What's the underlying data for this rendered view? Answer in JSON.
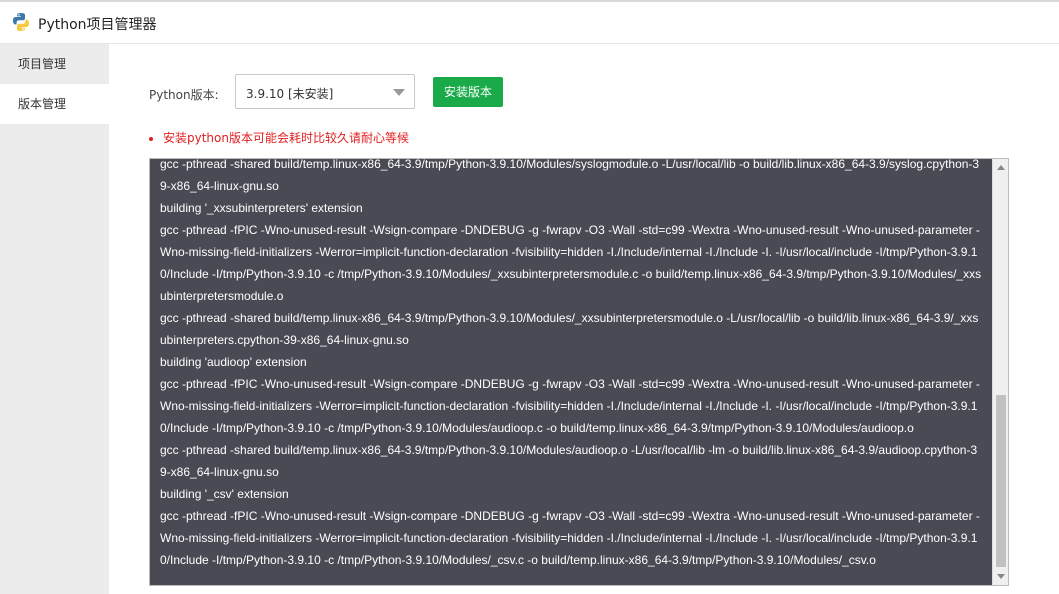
{
  "window": {
    "title": "Python项目管理器"
  },
  "sidebar": {
    "items": [
      {
        "label": "项目管理"
      },
      {
        "label": "版本管理"
      }
    ]
  },
  "version_form": {
    "label": "Python版本:",
    "selected": "3.9.10  [未安装]",
    "install_label": "安装版本"
  },
  "warning": {
    "text": "安装python版本可能会耗时比较久请耐心等候"
  },
  "log": {
    "lines": [
      "gcc -pthread -shared build/temp.linux-x86_64-3.9/tmp/Python-3.9.10/Modules/syslogmodule.o -L/usr/local/lib -o build/lib.linux-x86_64-3.9/syslog.cpython-39-x86_64-linux-gnu.so",
      "building '_xxsubinterpreters' extension",
      "gcc -pthread -fPIC -Wno-unused-result -Wsign-compare -DNDEBUG -g -fwrapv -O3 -Wall -std=c99 -Wextra -Wno-unused-result -Wno-unused-parameter -Wno-missing-field-initializers -Werror=implicit-function-declaration -fvisibility=hidden -I./Include/internal -I./Include -I. -I/usr/local/include -I/tmp/Python-3.9.10/Include -I/tmp/Python-3.9.10 -c /tmp/Python-3.9.10/Modules/_xxsubinterpretersmodule.c -o build/temp.linux-x86_64-3.9/tmp/Python-3.9.10/Modules/_xxsubinterpretersmodule.o",
      "gcc -pthread -shared build/temp.linux-x86_64-3.9/tmp/Python-3.9.10/Modules/_xxsubinterpretersmodule.o -L/usr/local/lib -o build/lib.linux-x86_64-3.9/_xxsubinterpreters.cpython-39-x86_64-linux-gnu.so",
      "building 'audioop' extension",
      "gcc -pthread -fPIC -Wno-unused-result -Wsign-compare -DNDEBUG -g -fwrapv -O3 -Wall -std=c99 -Wextra -Wno-unused-result -Wno-unused-parameter -Wno-missing-field-initializers -Werror=implicit-function-declaration -fvisibility=hidden -I./Include/internal -I./Include -I. -I/usr/local/include -I/tmp/Python-3.9.10/Include -I/tmp/Python-3.9.10 -c /tmp/Python-3.9.10/Modules/audioop.c -o build/temp.linux-x86_64-3.9/tmp/Python-3.9.10/Modules/audioop.o",
      "gcc -pthread -shared build/temp.linux-x86_64-3.9/tmp/Python-3.9.10/Modules/audioop.o -L/usr/local/lib -lm -o build/lib.linux-x86_64-3.9/audioop.cpython-39-x86_64-linux-gnu.so",
      "building '_csv' extension",
      "gcc -pthread -fPIC -Wno-unused-result -Wsign-compare -DNDEBUG -g -fwrapv -O3 -Wall -std=c99 -Wextra -Wno-unused-result -Wno-unused-parameter -Wno-missing-field-initializers -Werror=implicit-function-declaration -fvisibility=hidden -I./Include/internal -I./Include -I. -I/usr/local/include -I/tmp/Python-3.9.10/Include -I/tmp/Python-3.9.10 -c /tmp/Python-3.9.10/Modules/_csv.c -o build/temp.linux-x86_64-3.9/tmp/Python-3.9.10/Modules/_csv.o"
    ]
  },
  "colors": {
    "install_button": "#1aaa4a",
    "warning": "#e02020",
    "log_background": "#4a4a55"
  }
}
